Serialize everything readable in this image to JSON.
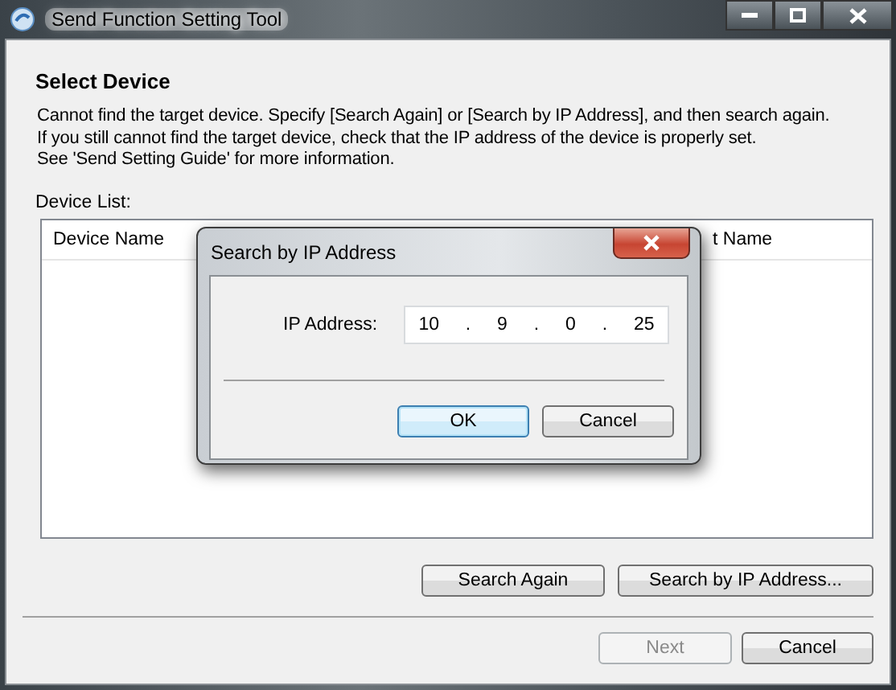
{
  "window": {
    "title": "Send Function Setting Tool"
  },
  "heading": "Select Device",
  "instructions": [
    "Cannot find the target device. Specify [Search Again] or [Search by IP Address], and then search again.",
    "If you still cannot find the target device, check that the IP address of the device is properly set.",
    "See 'Send Setting Guide' for more information."
  ],
  "device_list": {
    "label": "Device List:",
    "columns": [
      "Device Name",
      "t Name"
    ]
  },
  "actions": [
    "Search Again",
    "Search by IP Address..."
  ],
  "footer_buttons": [
    {
      "label": "Next",
      "disabled": true
    },
    {
      "label": "Cancel",
      "disabled": false
    }
  ],
  "dialog": {
    "title": "Search by IP Address",
    "field_label": "IP Address:",
    "octets": [
      "10",
      "9",
      "0",
      "25"
    ],
    "separator": ".",
    "buttons": [
      {
        "label": "OK",
        "default": true
      },
      {
        "label": "Cancel",
        "default": false
      }
    ]
  }
}
